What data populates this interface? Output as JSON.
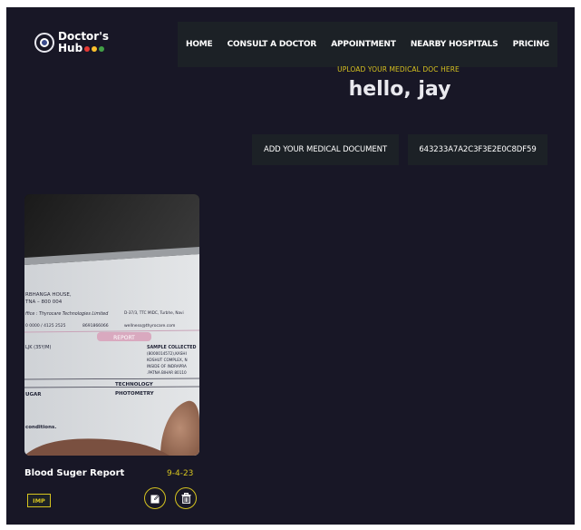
{
  "brand": {
    "line1": "Doctor's",
    "line2": "Hub",
    "dots": [
      "#e53935",
      "#fbc02d",
      "#43a047"
    ]
  },
  "nav": {
    "items": [
      {
        "label": "HOME"
      },
      {
        "label": "CONSULT A DOCTOR"
      },
      {
        "label": "APPOINTMENT"
      },
      {
        "label": "NEARBY HOSPITALS"
      },
      {
        "label": "PRICING"
      }
    ]
  },
  "hero": {
    "subtitle": "UPLOAD YOUR MEDICAL DOC HERE",
    "greeting": "hello, jay"
  },
  "actions": {
    "add_label": "ADD YOUR MEDICAL DOCUMENT",
    "user_id": "643233A7A2C3F3E2E0C8DF59"
  },
  "documents": [
    {
      "title": "Blood Suger Report",
      "date": "9-4-23",
      "tag": "IMP",
      "image_text": {
        "l1": "RBHANGA HOUSE,",
        "l2": "TNA – 800 004",
        "l3": "ffice : Thyrocare Technologies Limited",
        "l4": "D-37/3, TTC MIDC, Turbhe, Navi",
        "l5": "0 0000 / 4125 2525",
        "l6": "8691866066",
        "l7": "wellness@thyrocare.com",
        "report": "REPORT",
        "l8": "LJK (35Y/M)",
        "l9": "SAMPLE COLLECTED",
        "l10": "(8000014572),KASHI",
        "l11": "KOSHUT COMPLEX, N",
        "l12": "INSIDE OF INDRAPRA",
        "l13": ".PATNA BIHAR 80110",
        "l14": "TECHNOLOGY",
        "l15": "UGAR",
        "l16": "PHOTOMETRY",
        "l17": "conditions."
      }
    }
  ],
  "colors": {
    "accent": "#d6c41f",
    "background": "#181726",
    "panel": "#1c2126"
  }
}
